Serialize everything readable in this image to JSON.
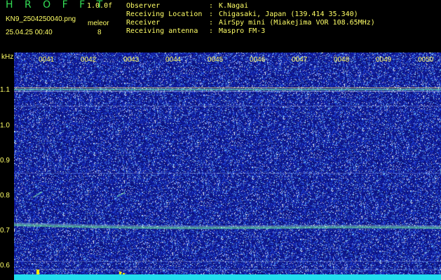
{
  "header": {
    "app_logo": "H R O F F T",
    "version": "1.0.0f",
    "filename": "KN9_2504250040.png",
    "datetime": "25.04.25 00:40",
    "meleor_label": "meleor",
    "meleor_count": "8"
  },
  "info": [
    {
      "key": "Observer",
      "sep": ":",
      "value": "K.Nagai"
    },
    {
      "key": "Receiving Location",
      "sep": ":",
      "value": "Chigasaki, Japan (139.414 35.340)"
    },
    {
      "key": "Receiver",
      "sep": ":",
      "value": "AirSpy mini (Miakejima VOR 108.65MHz)"
    },
    {
      "key": "Receiving antenna",
      "sep": ":",
      "value": "Maspro FM-3"
    }
  ],
  "axis": {
    "y_unit": "kHz",
    "y_ticks": [
      "1.1",
      "1.0",
      "0.9",
      "0.8",
      "0.7",
      "0.6"
    ],
    "x_ticks": [
      "0041",
      "0042",
      "0043",
      "0044",
      "0045",
      "0046",
      "0047",
      "0048",
      "0049",
      "0050"
    ]
  },
  "colors": {
    "background": "#1a1fa0",
    "label": "#ffff66",
    "logo": "#33dd55",
    "bottom_bar": "#22ddee"
  }
}
